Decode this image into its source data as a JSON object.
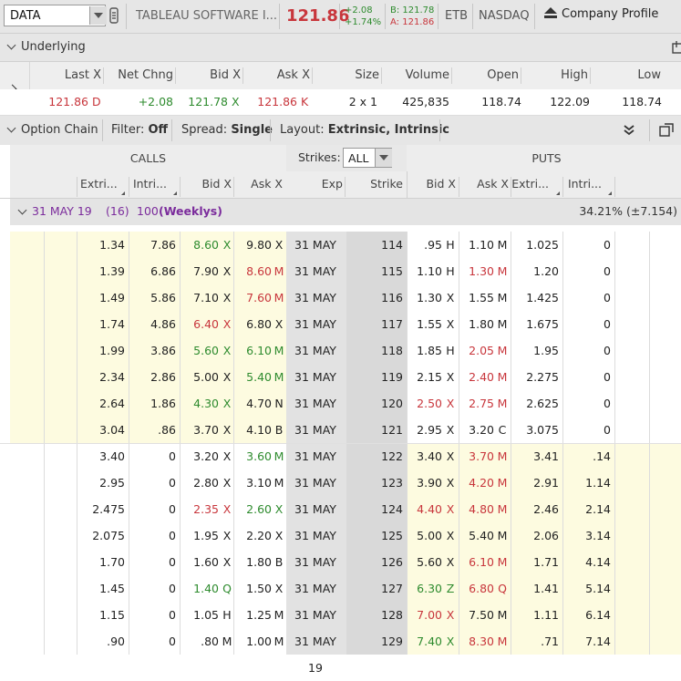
{
  "topbar": {
    "symbol": "DATA",
    "company": "TABLEAU SOFTWARE I...",
    "last": "121.86",
    "net_change": "+2.08",
    "pct_change": "+1.74%",
    "bid": "B: 121.78",
    "ask": "A: 121.86",
    "etb": "ETB",
    "exchange": "NASDAQ",
    "profile_label": "Company Profile"
  },
  "underlying": {
    "title": "Underlying",
    "columns": [
      "Last X",
      "Net Chng",
      "Bid X",
      "Ask X",
      "Size",
      "Volume",
      "Open",
      "High",
      "Low"
    ],
    "last": "121.86",
    "last_ex": "D",
    "net_chng": "+2.08",
    "bid": "121.78",
    "bid_ex": "X",
    "ask": "121.86",
    "ask_ex": "K",
    "size": "2 x 1",
    "volume": "425,835",
    "open": "118.74",
    "high": "122.09",
    "low": "118.74"
  },
  "option_chain": {
    "title": "Option Chain",
    "filter_label": "Filter:",
    "filter_value": "Off",
    "spread_label": "Spread:",
    "spread_value": "Single",
    "layout_label": "Layout:",
    "layout_value": "Extrinsic, Intrinsic",
    "calls_label": "CALLS",
    "puts_label": "PUTS",
    "strikes_label": "Strikes:",
    "strikes_value": "ALL",
    "columns": {
      "c_extr": "Extri...",
      "c_intr": "Intri...",
      "c_bid": "Bid X",
      "c_ask": "Ask X",
      "exp": "Exp",
      "strike": "Strike",
      "p_bid": "Bid X",
      "p_ask": "Ask X",
      "p_extr": "Extri...",
      "p_intr": "Intri..."
    },
    "expiration": {
      "date": "31 MAY 19",
      "days": "(16)",
      "multiplier": "100",
      "type": "(Weeklys)",
      "iv": "34.21% (±7.154)"
    },
    "rows": [
      {
        "c_extr": "1.34",
        "c_intr": "7.86",
        "c_bid": "8.60",
        "c_bid_ex": "X",
        "c_ask": "9.80",
        "c_ask_ex": "X",
        "exp": "31 MAY 19",
        "strike": "114",
        "p_bid": ".95",
        "p_bid_ex": "H",
        "p_ask": "1.10",
        "p_ask_ex": "M",
        "p_extr": "1.025",
        "p_intr": "0"
      },
      {
        "c_extr": "1.39",
        "c_intr": "6.86",
        "c_bid": "7.90",
        "c_bid_ex": "X",
        "c_ask": "8.60",
        "c_ask_ex": "M",
        "exp": "31 MAY 19",
        "strike": "115",
        "p_bid": "1.10",
        "p_bid_ex": "H",
        "p_ask": "1.30",
        "p_ask_ex": "M",
        "p_extr": "1.20",
        "p_intr": "0"
      },
      {
        "c_extr": "1.49",
        "c_intr": "5.86",
        "c_bid": "7.10",
        "c_bid_ex": "X",
        "c_ask": "7.60",
        "c_ask_ex": "M",
        "exp": "31 MAY 19",
        "strike": "116",
        "p_bid": "1.30",
        "p_bid_ex": "X",
        "p_ask": "1.55",
        "p_ask_ex": "M",
        "p_extr": "1.425",
        "p_intr": "0"
      },
      {
        "c_extr": "1.74",
        "c_intr": "4.86",
        "c_bid": "6.40",
        "c_bid_ex": "X",
        "c_ask": "6.80",
        "c_ask_ex": "X",
        "exp": "31 MAY 19",
        "strike": "117",
        "p_bid": "1.55",
        "p_bid_ex": "X",
        "p_ask": "1.80",
        "p_ask_ex": "M",
        "p_extr": "1.675",
        "p_intr": "0"
      },
      {
        "c_extr": "1.99",
        "c_intr": "3.86",
        "c_bid": "5.60",
        "c_bid_ex": "X",
        "c_ask": "6.10",
        "c_ask_ex": "M",
        "exp": "31 MAY 19",
        "strike": "118",
        "p_bid": "1.85",
        "p_bid_ex": "H",
        "p_ask": "2.05",
        "p_ask_ex": "M",
        "p_extr": "1.95",
        "p_intr": "0"
      },
      {
        "c_extr": "2.34",
        "c_intr": "2.86",
        "c_bid": "5.00",
        "c_bid_ex": "X",
        "c_ask": "5.40",
        "c_ask_ex": "M",
        "exp": "31 MAY 19",
        "strike": "119",
        "p_bid": "2.15",
        "p_bid_ex": "X",
        "p_ask": "2.40",
        "p_ask_ex": "M",
        "p_extr": "2.275",
        "p_intr": "0"
      },
      {
        "c_extr": "2.64",
        "c_intr": "1.86",
        "c_bid": "4.30",
        "c_bid_ex": "X",
        "c_ask": "4.70",
        "c_ask_ex": "N",
        "exp": "31 MAY 19",
        "strike": "120",
        "p_bid": "2.50",
        "p_bid_ex": "X",
        "p_ask": "2.75",
        "p_ask_ex": "M",
        "p_extr": "2.625",
        "p_intr": "0"
      },
      {
        "c_extr": "3.04",
        "c_intr": ".86",
        "c_bid": "3.70",
        "c_bid_ex": "X",
        "c_ask": "4.10",
        "c_ask_ex": "B",
        "exp": "31 MAY 19",
        "strike": "121",
        "p_bid": "2.95",
        "p_bid_ex": "X",
        "p_ask": "3.20",
        "p_ask_ex": "C",
        "p_extr": "3.075",
        "p_intr": "0"
      },
      {
        "c_extr": "3.40",
        "c_intr": "0",
        "c_bid": "3.20",
        "c_bid_ex": "X",
        "c_ask": "3.60",
        "c_ask_ex": "M",
        "exp": "31 MAY 19",
        "strike": "122",
        "p_bid": "3.40",
        "p_bid_ex": "X",
        "p_ask": "3.70",
        "p_ask_ex": "M",
        "p_extr": "3.41",
        "p_intr": ".14"
      },
      {
        "c_extr": "2.95",
        "c_intr": "0",
        "c_bid": "2.80",
        "c_bid_ex": "X",
        "c_ask": "3.10",
        "c_ask_ex": "M",
        "exp": "31 MAY 19",
        "strike": "123",
        "p_bid": "3.90",
        "p_bid_ex": "X",
        "p_ask": "4.20",
        "p_ask_ex": "M",
        "p_extr": "2.91",
        "p_intr": "1.14"
      },
      {
        "c_extr": "2.475",
        "c_intr": "0",
        "c_bid": "2.35",
        "c_bid_ex": "X",
        "c_ask": "2.60",
        "c_ask_ex": "X",
        "exp": "31 MAY 19",
        "strike": "124",
        "p_bid": "4.40",
        "p_bid_ex": "X",
        "p_ask": "4.80",
        "p_ask_ex": "M",
        "p_extr": "2.46",
        "p_intr": "2.14"
      },
      {
        "c_extr": "2.075",
        "c_intr": "0",
        "c_bid": "1.95",
        "c_bid_ex": "X",
        "c_ask": "2.20",
        "c_ask_ex": "X",
        "exp": "31 MAY 19",
        "strike": "125",
        "p_bid": "5.00",
        "p_bid_ex": "X",
        "p_ask": "5.40",
        "p_ask_ex": "M",
        "p_extr": "2.06",
        "p_intr": "3.14"
      },
      {
        "c_extr": "1.70",
        "c_intr": "0",
        "c_bid": "1.60",
        "c_bid_ex": "X",
        "c_ask": "1.80",
        "c_ask_ex": "B",
        "exp": "31 MAY 19",
        "strike": "126",
        "p_bid": "5.60",
        "p_bid_ex": "X",
        "p_ask": "6.10",
        "p_ask_ex": "M",
        "p_extr": "1.71",
        "p_intr": "4.14"
      },
      {
        "c_extr": "1.45",
        "c_intr": "0",
        "c_bid": "1.40",
        "c_bid_ex": "Q",
        "c_ask": "1.50",
        "c_ask_ex": "X",
        "exp": "31 MAY 19",
        "strike": "127",
        "p_bid": "6.30",
        "p_bid_ex": "Z",
        "p_ask": "6.80",
        "p_ask_ex": "Q",
        "p_extr": "1.41",
        "p_intr": "5.14"
      },
      {
        "c_extr": "1.15",
        "c_intr": "0",
        "c_bid": "1.05",
        "c_bid_ex": "H",
        "c_ask": "1.25",
        "c_ask_ex": "M",
        "exp": "31 MAY 19",
        "strike": "128",
        "p_bid": "7.00",
        "p_bid_ex": "X",
        "p_ask": "7.50",
        "p_ask_ex": "M",
        "p_extr": "1.11",
        "p_intr": "6.14"
      },
      {
        "c_extr": ".90",
        "c_intr": "0",
        "c_bid": ".80",
        "c_bid_ex": "M",
        "c_ask": "1.00",
        "c_ask_ex": "M",
        "exp": "31 MAY 19",
        "strike": "129",
        "p_bid": "7.40",
        "p_bid_ex": "X",
        "p_ask": "8.30",
        "p_ask_ex": "M",
        "p_extr": ".71",
        "p_intr": "7.14"
      }
    ],
    "row_styles": [
      {
        "c_bid": "green",
        "c_ask": "",
        "p_bid": "",
        "p_ask": ""
      },
      {
        "c_bid": "",
        "c_ask": "red",
        "p_bid": "",
        "p_ask": "red"
      },
      {
        "c_bid": "",
        "c_ask": "red",
        "p_bid": "",
        "p_ask": ""
      },
      {
        "c_bid": "red",
        "c_ask": "",
        "p_bid": "",
        "p_ask": ""
      },
      {
        "c_bid": "green",
        "c_ask": "green",
        "p_bid": "",
        "p_ask": "red"
      },
      {
        "c_bid": "",
        "c_ask": "green",
        "p_bid": "",
        "p_ask": "red"
      },
      {
        "c_bid": "green",
        "c_ask": "",
        "p_bid": "red",
        "p_ask": "red"
      },
      {
        "c_bid": "",
        "c_ask": "",
        "p_bid": "",
        "p_ask": ""
      },
      {
        "c_bid": "",
        "c_ask": "green",
        "p_bid": "",
        "p_ask": "red"
      },
      {
        "c_bid": "",
        "c_ask": "",
        "p_bid": "",
        "p_ask": "red"
      },
      {
        "c_bid": "red",
        "c_ask": "green",
        "p_bid": "red",
        "p_ask": "red"
      },
      {
        "c_bid": "",
        "c_ask": "",
        "p_bid": "",
        "p_ask": ""
      },
      {
        "c_bid": "",
        "c_ask": "",
        "p_bid": "",
        "p_ask": "red"
      },
      {
        "c_bid": "green",
        "c_ask": "",
        "p_bid": "green",
        "p_ask": "red"
      },
      {
        "c_bid": "",
        "c_ask": "",
        "p_bid": "red",
        "p_ask": ""
      },
      {
        "c_bid": "",
        "c_ask": "",
        "p_bid": "green",
        "p_ask": "red"
      }
    ],
    "itm_calls_count": 8
  },
  "colors": {
    "itm": "#fdfbe0",
    "strike_col": "#e2e2e2",
    "header_bg": "#e6e6e6",
    "up": "#2e8b2e",
    "down": "#c8363c",
    "weeklys": "#7b2c9c"
  }
}
